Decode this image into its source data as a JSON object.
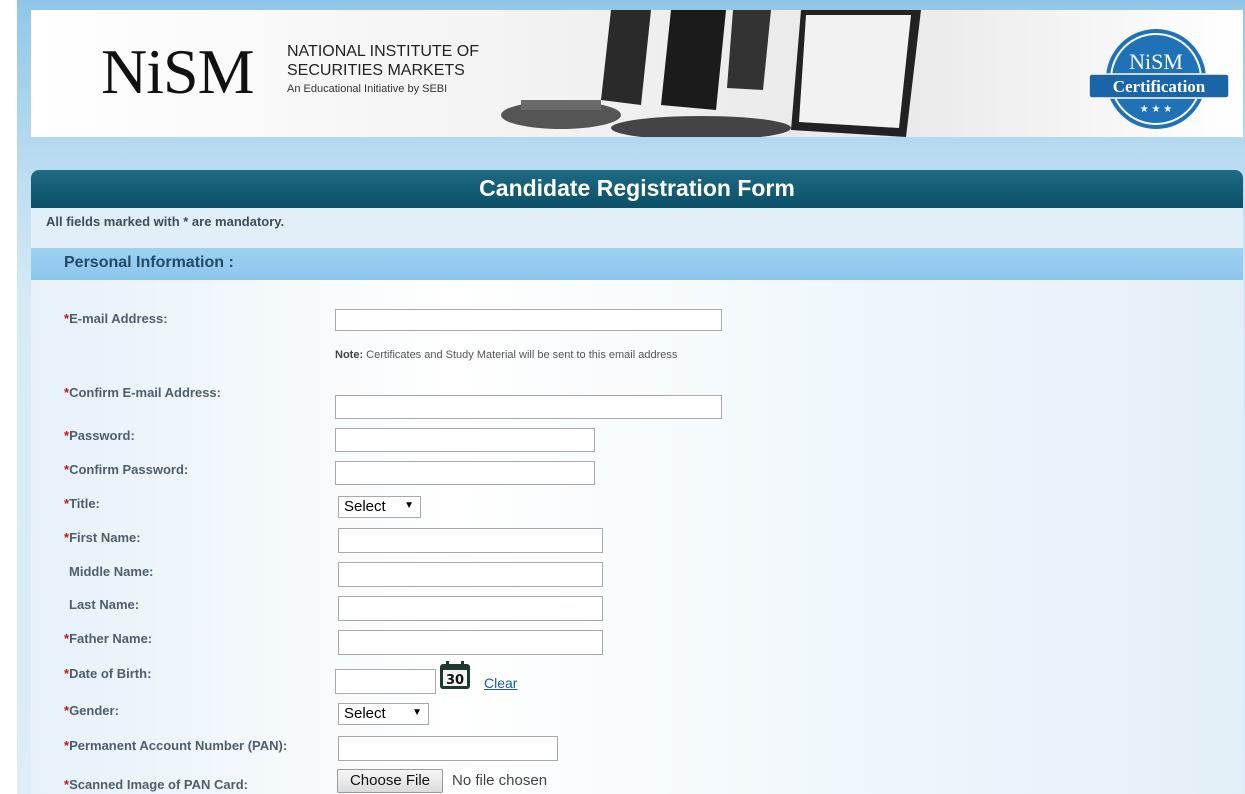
{
  "header": {
    "logo_text": "NiSM",
    "institute_line1": "NATIONAL INSTITUTE OF",
    "institute_line2": "SECURITIES MARKETS",
    "institute_tagline": "An Educational Initiative by SEBI",
    "badge_top": "NiSM",
    "badge_bottom": "Certification"
  },
  "form": {
    "title": "Candidate Registration Form",
    "mandatory_note": "All fields marked with * are mandatory.",
    "section_title": "Personal Information :",
    "required_mark": "*",
    "email_note_label": "Note:",
    "email_note_text": " Certificates and Study Material will be sent to this email address",
    "fields": {
      "email": {
        "label": "E-mail Address:",
        "value": ""
      },
      "confirm_email": {
        "label": "Confirm E-mail Address:",
        "value": ""
      },
      "password": {
        "label": "Password:",
        "value": ""
      },
      "confirm_password": {
        "label": "Confirm Password:",
        "value": ""
      },
      "title": {
        "label": "Title:",
        "selected": "Select"
      },
      "first_name": {
        "label": "First Name:",
        "value": ""
      },
      "middle_name": {
        "label": "Middle Name:",
        "value": ""
      },
      "last_name": {
        "label": "Last Name:",
        "value": ""
      },
      "father_name": {
        "label": "Father Name:",
        "value": ""
      },
      "dob": {
        "label": "Date of Birth:",
        "value": "",
        "calendar_day": "30",
        "clear_label": "Clear"
      },
      "gender": {
        "label": "Gender:",
        "selected": "Select"
      },
      "pan": {
        "label": "Permanent Account Number (PAN):",
        "value": ""
      },
      "pan_image": {
        "label": "Scanned Image of PAN Card:",
        "button_label": "Choose File",
        "status": "No file chosen"
      }
    }
  },
  "colors": {
    "header_bar": "#0b4f68",
    "section_bar": "#8cc6ec",
    "required": "#cc1111",
    "link": "#1a5aa8"
  }
}
